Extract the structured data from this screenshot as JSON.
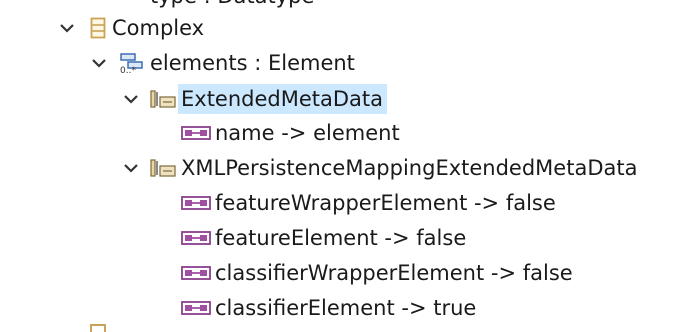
{
  "tree": {
    "partial_top_label": "type : Datatype",
    "nodes": [
      {
        "label": "Complex",
        "icon": "class-icon",
        "expanded": true
      },
      {
        "label": "elements : Element",
        "icon": "reference-icon",
        "expanded": true
      },
      {
        "label": "ExtendedMetaData",
        "icon": "annotation-icon",
        "expanded": true,
        "selected": true
      },
      {
        "label": "name -> element",
        "icon": "entry-icon"
      },
      {
        "label": "XMLPersistenceMappingExtendedMetaData",
        "icon": "annotation-icon",
        "expanded": true
      },
      {
        "label": "featureWrapperElement -> false",
        "icon": "entry-icon"
      },
      {
        "label": "featureElement -> false",
        "icon": "entry-icon"
      },
      {
        "label": "classifierWrapperElement -> false",
        "icon": "entry-icon"
      },
      {
        "label": "classifierElement -> true",
        "icon": "entry-icon"
      }
    ]
  },
  "colors": {
    "selection": "#cce8ff",
    "entry_icon": "#a050a0",
    "class_icon": "#c9a35a",
    "reference_icon": "#3c6eb4"
  }
}
